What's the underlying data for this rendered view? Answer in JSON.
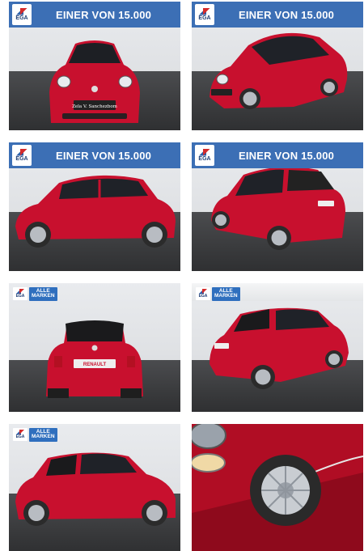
{
  "banner": {
    "title": "EINER VON 15.000",
    "logo_text": "EGA"
  },
  "badge": {
    "logo_text": "EGA",
    "line1": "ALLE",
    "line2": "MARKEN"
  },
  "plate": {
    "front": "Zela V. Sanchezbom",
    "rear": "RENAULT"
  },
  "colors": {
    "banner_blue": "#3c6fb5",
    "car_red": "#c8102e"
  },
  "photos": [
    {
      "id": "front"
    },
    {
      "id": "front-three-quarter"
    },
    {
      "id": "side-left"
    },
    {
      "id": "rear-three-quarter"
    },
    {
      "id": "rear"
    },
    {
      "id": "rear-three-quarter-right"
    },
    {
      "id": "side-right"
    },
    {
      "id": "wheel-detail"
    }
  ]
}
